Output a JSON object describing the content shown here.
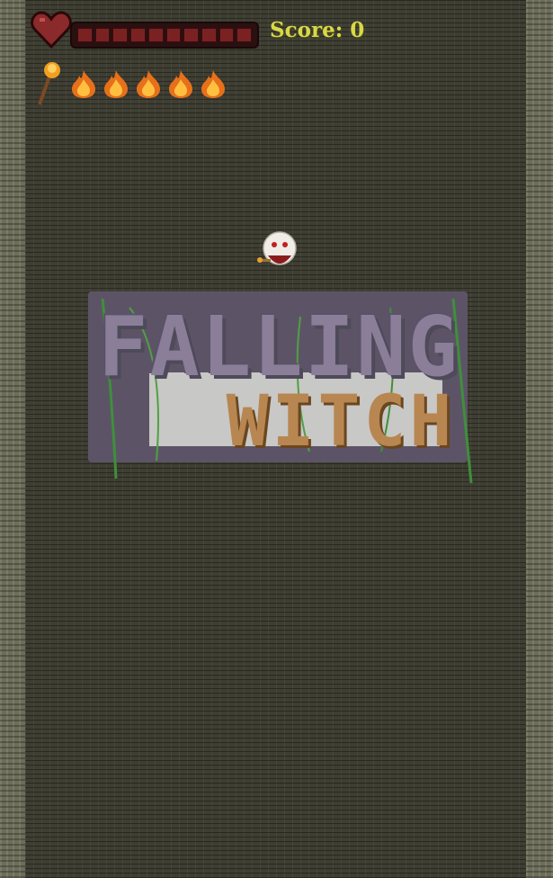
{
  "hud": {
    "score_text": "Score: 0",
    "health_fraction": 1.0,
    "health_segments": 10,
    "fireball_ammo": 5,
    "icons": [
      "heart-icon",
      "staff-icon",
      "flame-icon"
    ]
  },
  "logo": {
    "line1": "FALLING",
    "line2": "WITCH"
  },
  "colors": {
    "background": "#3e3e33",
    "side_wall": "#6d6d5b",
    "score_text": "#d8d84a",
    "health_fill": "#7a2222",
    "logo_title": "#8a7e98",
    "logo_subtitle": "#b88650",
    "vines": "#3f8f3a"
  }
}
